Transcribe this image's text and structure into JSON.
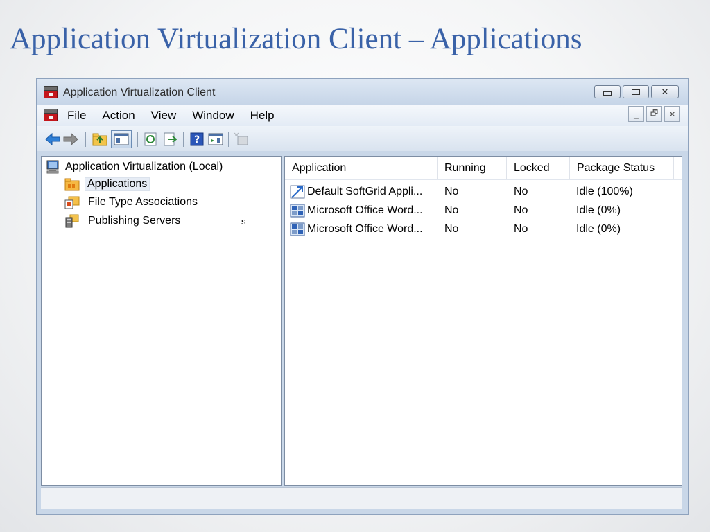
{
  "slide": {
    "title": "Application Virtualization Client – Applications"
  },
  "window": {
    "title": "Application Virtualization Client",
    "app_icon": "toolbox-icon",
    "caption_buttons": [
      "minimize-icon",
      "maximize-icon",
      "close-icon"
    ]
  },
  "menubar": {
    "items": [
      "File",
      "Action",
      "View",
      "Window",
      "Help"
    ],
    "mdi_buttons": [
      "minimize-icon",
      "restore-icon",
      "close-icon"
    ]
  },
  "toolbar": {
    "buttons": [
      "back-arrow-icon",
      "forward-arrow-icon",
      "up-folder-icon",
      "show-hide-tree-icon",
      "refresh-icon",
      "export-list-icon",
      "help-icon",
      "properties-icon",
      "action-pane-icon"
    ]
  },
  "tree": {
    "root": "Application Virtualization (Local)",
    "items": [
      {
        "label": "Applications",
        "icon": "applications-folder-icon",
        "selected": true
      },
      {
        "label": "File Type Associations",
        "icon": "file-type-folder-icon",
        "selected": false
      },
      {
        "label": "Publishing Servers",
        "icon": "server-icon",
        "selected": false
      }
    ],
    "stray_glyph": "s"
  },
  "list": {
    "columns": [
      "Application",
      "Running",
      "Locked",
      "Package Status"
    ],
    "rows": [
      {
        "application": "Default SoftGrid Appli...",
        "running": "No",
        "locked": "No",
        "status": "Idle (100%)",
        "icon": "softgrid-app-icon"
      },
      {
        "application": "Microsoft Office Word...",
        "running": "No",
        "locked": "No",
        "status": "Idle (0%)",
        "icon": "word-app-icon"
      },
      {
        "application": "Microsoft Office Word...",
        "running": "No",
        "locked": "No",
        "status": "Idle (0%)",
        "icon": "word-app-icon"
      }
    ]
  },
  "colors": {
    "slide_title": "#3a62a8",
    "window_frame": "#c9d7e8",
    "selection": "#e6ecf5"
  }
}
